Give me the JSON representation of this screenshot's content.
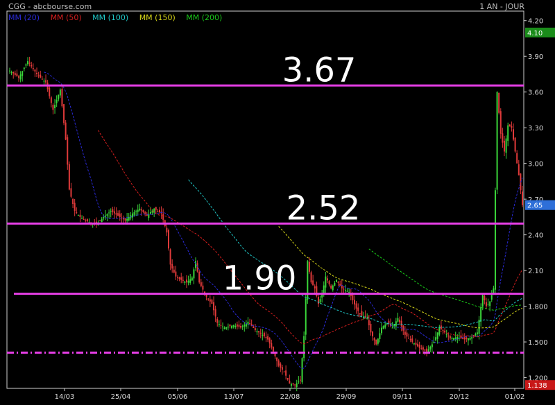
{
  "header": {
    "source": "CGG - abcbourse.com",
    "period": "1 AN - JOUR"
  },
  "chart_data": {
    "type": "candlestick",
    "title": "",
    "ylim": [
      1.11,
      4.28
    ],
    "y_ticks": [
      "4.20",
      "3.90",
      "3.60",
      "3.30",
      "3.00",
      "2.70",
      "2.40",
      "2.10",
      "1.800",
      "1.500",
      "1.200"
    ],
    "x_ticks": [
      "14/03",
      "25/04",
      "05/06",
      "13/07",
      "22/08",
      "29/09",
      "09/11",
      "20/12",
      "01/02"
    ],
    "legend": [
      {
        "label": "MM (20)",
        "color": "#2a2ad8"
      },
      {
        "label": "MM (50)",
        "color": "#d81e1e"
      },
      {
        "label": "MM (100)",
        "color": "#20c8c8"
      },
      {
        "label": "MM (150)",
        "color": "#d8d818"
      },
      {
        "label": "MM (200)",
        "color": "#19c819"
      }
    ],
    "price_badges": [
      {
        "label": "4.10",
        "value": 4.1,
        "color": "#1a8c1a"
      },
      {
        "label": "2.65",
        "value": 2.65,
        "color": "#2e6fd8"
      },
      {
        "label": "1.138",
        "value": 1.138,
        "color": "#c81818"
      }
    ],
    "level_lines": [
      {
        "label": "3.67",
        "value": 3.655
      },
      {
        "label": "2.52",
        "value": 2.495
      },
      {
        "label": "1.90",
        "value": 1.905
      },
      {
        "label": "",
        "value": 1.41,
        "style": "dash-dot"
      }
    ],
    "colors": {
      "up": "#3ad63a",
      "down": "#e03a3a",
      "level": "#e63ee6",
      "grid": "#cfcfcf",
      "axis_text": "#dcdcdc"
    },
    "price_path": [
      [
        0,
        3.78
      ],
      [
        5,
        3.72
      ],
      [
        10,
        3.86
      ],
      [
        15,
        3.75
      ],
      [
        20,
        3.68
      ],
      [
        24,
        3.45
      ],
      [
        28,
        3.62
      ],
      [
        31,
        3.2
      ],
      [
        33,
        2.78
      ],
      [
        36,
        2.6
      ],
      [
        39,
        2.55
      ],
      [
        42,
        2.52
      ],
      [
        45,
        2.5
      ],
      [
        48,
        2.49
      ],
      [
        52,
        2.55
      ],
      [
        56,
        2.6
      ],
      [
        60,
        2.56
      ],
      [
        64,
        2.52
      ],
      [
        68,
        2.58
      ],
      [
        72,
        2.62
      ],
      [
        76,
        2.56
      ],
      [
        80,
        2.62
      ],
      [
        84,
        2.58
      ],
      [
        87,
        2.42
      ],
      [
        89,
        2.15
      ],
      [
        92,
        2.05
      ],
      [
        95,
        2.02
      ],
      [
        98,
        2.0
      ],
      [
        101,
        2.04
      ],
      [
        103,
        2.18
      ],
      [
        105,
        2.0
      ],
      [
        109,
        1.88
      ],
      [
        112,
        1.82
      ],
      [
        115,
        1.66
      ],
      [
        119,
        1.62
      ],
      [
        124,
        1.64
      ],
      [
        128,
        1.62
      ],
      [
        132,
        1.67
      ],
      [
        136,
        1.6
      ],
      [
        140,
        1.56
      ],
      [
        143,
        1.52
      ],
      [
        146,
        1.42
      ],
      [
        149,
        1.3
      ],
      [
        152,
        1.25
      ],
      [
        155,
        1.15
      ],
      [
        158,
        1.14
      ],
      [
        161,
        1.18
      ],
      [
        163,
        1.55
      ],
      [
        165,
        2.18
      ],
      [
        167,
        2.0
      ],
      [
        169,
        1.95
      ],
      [
        171,
        1.82
      ],
      [
        173,
        1.9
      ],
      [
        175,
        2.05
      ],
      [
        178,
        1.95
      ],
      [
        181,
        2.02
      ],
      [
        184,
        1.95
      ],
      [
        188,
        1.92
      ],
      [
        192,
        1.78
      ],
      [
        195,
        1.72
      ],
      [
        198,
        1.7
      ],
      [
        200,
        1.58
      ],
      [
        203,
        1.48
      ],
      [
        206,
        1.62
      ],
      [
        209,
        1.66
      ],
      [
        212,
        1.62
      ],
      [
        215,
        1.7
      ],
      [
        219,
        1.56
      ],
      [
        223,
        1.5
      ],
      [
        227,
        1.45
      ],
      [
        231,
        1.42
      ],
      [
        235,
        1.5
      ],
      [
        238,
        1.62
      ],
      [
        241,
        1.58
      ],
      [
        244,
        1.53
      ],
      [
        248,
        1.54
      ],
      [
        252,
        1.52
      ],
      [
        256,
        1.54
      ],
      [
        259,
        1.58
      ],
      [
        262,
        1.9
      ],
      [
        264,
        1.8
      ],
      [
        266,
        1.84
      ],
      [
        268,
        1.95
      ],
      [
        270,
        3.6
      ],
      [
        272,
        3.25
      ],
      [
        274,
        3.1
      ],
      [
        276,
        3.32
      ],
      [
        278,
        3.3
      ],
      [
        280,
        3.1
      ],
      [
        282,
        2.9
      ],
      [
        284,
        2.65
      ]
    ]
  }
}
